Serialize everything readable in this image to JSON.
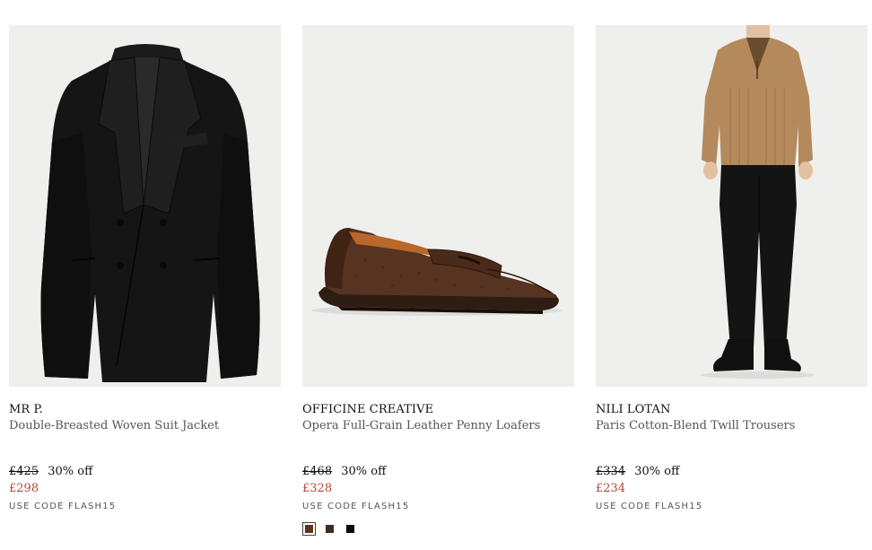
{
  "products": [
    {
      "brand": "MR P.",
      "name": "Double-Breasted Woven Suit Jacket",
      "original_price": "£425",
      "discount": "30% off",
      "sale_price": "£298",
      "promo": "USE CODE FLASH15"
    },
    {
      "brand": "OFFICINE CREATIVE",
      "name": "Opera Full-Grain Leather Penny Loafers",
      "original_price": "£468",
      "discount": "30% off",
      "sale_price": "£328",
      "promo": "USE CODE FLASH15",
      "swatches": [
        {
          "color": "#5a3520",
          "selected": true
        },
        {
          "color": "#3f2b26",
          "selected": false
        },
        {
          "color": "#0a0a0a",
          "selected": false
        }
      ]
    },
    {
      "brand": "NILI LOTAN",
      "name": "Paris Cotton-Blend Twill Trousers",
      "original_price": "£334",
      "discount": "30% off",
      "sale_price": "£234",
      "promo": "USE CODE FLASH15"
    }
  ],
  "colors": {
    "sale_price": "#b0452e",
    "image_background": "#efefee"
  }
}
